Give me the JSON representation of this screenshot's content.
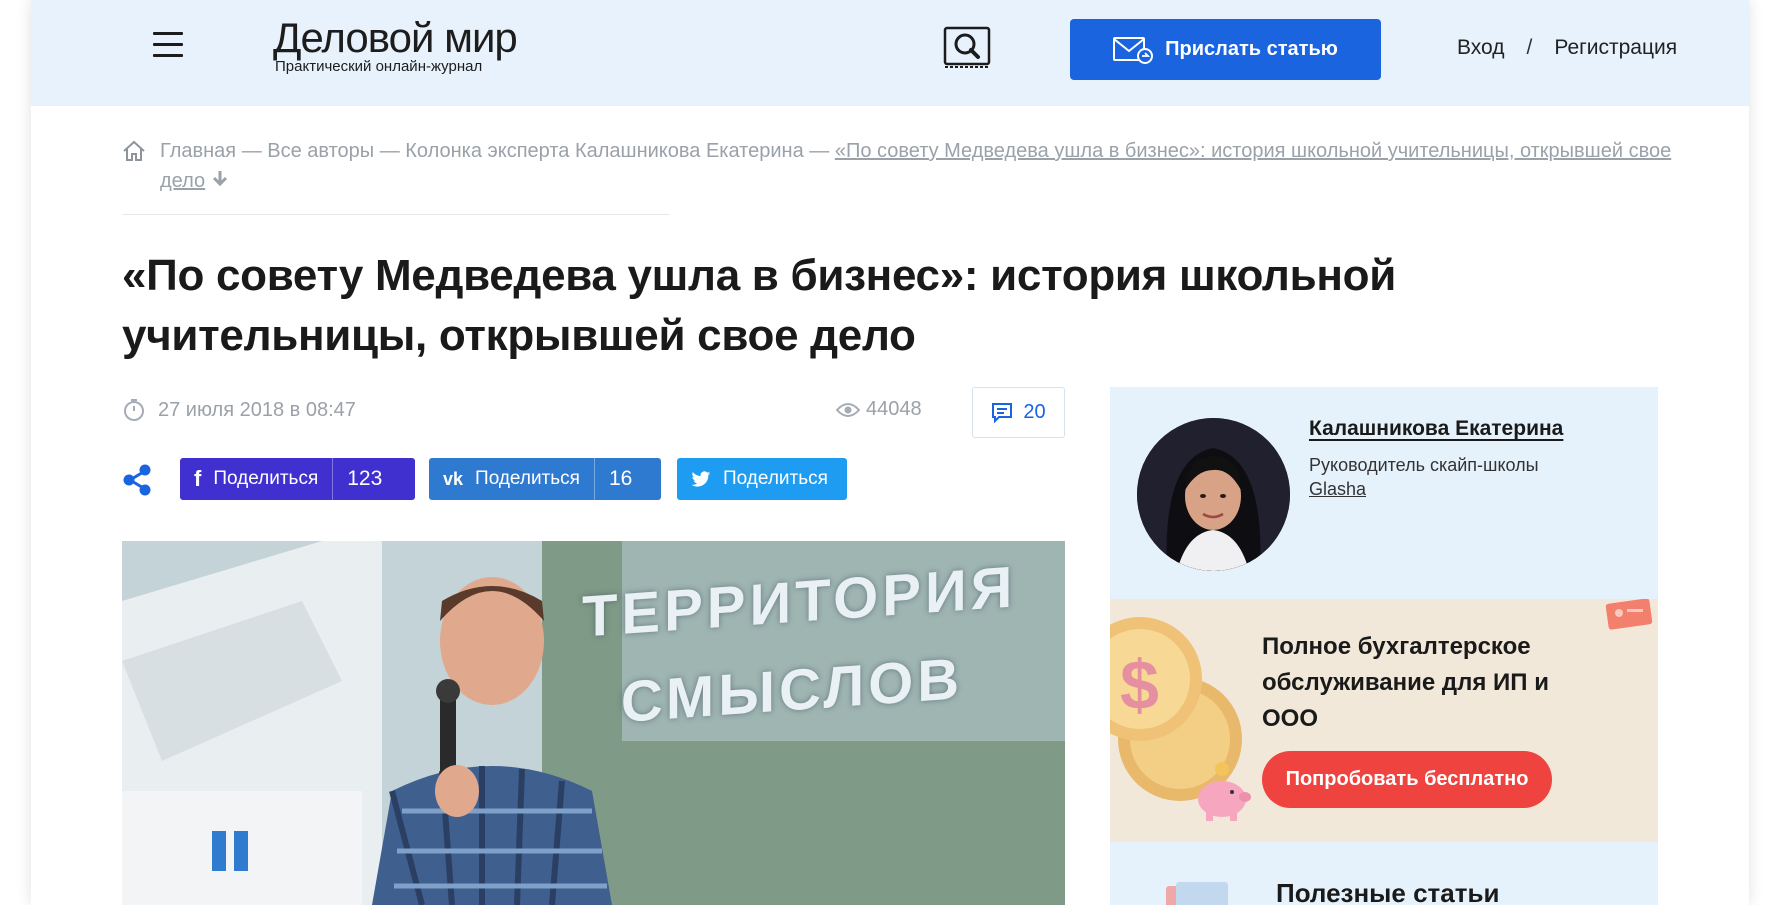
{
  "header": {
    "logo_name": "Деловой мир",
    "logo_sub": "Практический онлайн-журнал",
    "send_label": "Прислать статью",
    "login": "Вход",
    "separator": "/",
    "register": "Регистрация"
  },
  "breadcrumb": {
    "items": [
      "Главная",
      "Все авторы",
      "Колонка эксперта Калашникова Екатерина"
    ],
    "separator": "—",
    "current": "«По совету Медведева ушла в бизнес»: история школьной учительницы, открывшей свое дело"
  },
  "article": {
    "title": "«По совету Медведева ушла в бизнес»: история школьной учительницы, открывшей свое дело",
    "date": "27 июля 2018 в 08:47",
    "views": "44048",
    "comments": "20",
    "photo_text": "ТЕРРИТОРИЯ СМЫСЛОВ"
  },
  "share": {
    "fb": {
      "label": "Поделиться",
      "count": "123"
    },
    "vk": {
      "label": "Поделиться",
      "count": "16"
    },
    "tw": {
      "label": "Поделиться"
    }
  },
  "sidebar": {
    "author": {
      "name": "Калашникова Екатерина",
      "role": "Руководитель скайп-школы",
      "company": "Glasha"
    },
    "promo": {
      "title": "Полное бухгалтерское обслуживание для ИП и ООО",
      "button": "Попробовать бесплатно"
    },
    "useful": {
      "title": "Полезные статьи"
    }
  },
  "colors": {
    "header_bg": "#e7f2fc",
    "brand_blue": "#1a64e0",
    "fb": "#4030cf",
    "vk": "#2f7ad1",
    "tw": "#1e9cf1",
    "promo_red": "#ef4340"
  }
}
